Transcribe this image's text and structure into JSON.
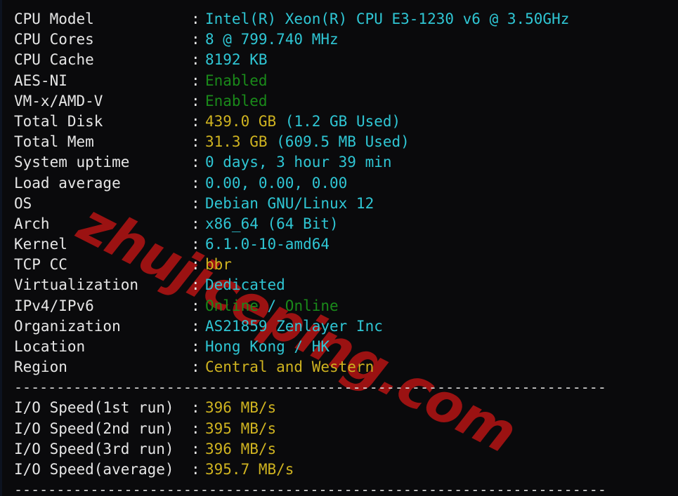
{
  "terminal": {
    "background": "#0a0a0c",
    "watermark": "zhujiceping.com",
    "watermark_color": "#9b1212",
    "separator_top": "----------------------------------------------------------------------",
    "separator_mid": "----------------------------------------------------------------------",
    "separator_bottom": "----------------------------------------------------------------------",
    "colon": ":"
  },
  "colors": {
    "label": "#e6e6e6",
    "cyan": "#2fc6d4",
    "yellow": "#cfb320",
    "green": "#1a8a1a"
  },
  "system_info": [
    {
      "label": "CPU Model",
      "value": "Intel(R) Xeon(R) CPU E3-1230 v6 @ 3.50GHz",
      "color": "cyan"
    },
    {
      "label": "CPU Cores",
      "value": "8 @ 799.740 MHz",
      "color": "cyan"
    },
    {
      "label": "CPU Cache",
      "value": "8192 KB",
      "color": "cyan"
    },
    {
      "label": "AES-NI",
      "value": "Enabled",
      "color": "green"
    },
    {
      "label": "VM-x/AMD-V",
      "value": "Enabled",
      "color": "green"
    },
    {
      "label": "Total Disk",
      "value": "439.0 GB (1.2 GB Used)",
      "color": "split",
      "parts": [
        {
          "text": "439.0 GB ",
          "color": "yellow"
        },
        {
          "text": "(1.2 GB Used)",
          "color": "cyan"
        }
      ]
    },
    {
      "label": "Total Mem",
      "value": "31.3 GB (609.5 MB Used)",
      "color": "split",
      "parts": [
        {
          "text": "31.3 GB ",
          "color": "yellow"
        },
        {
          "text": "(609.5 MB Used)",
          "color": "cyan"
        }
      ]
    },
    {
      "label": "System uptime",
      "value": "0 days, 3 hour 39 min",
      "color": "cyan"
    },
    {
      "label": "Load average",
      "value": "0.00, 0.00, 0.00",
      "color": "cyan"
    },
    {
      "label": "OS",
      "value": "Debian GNU/Linux 12",
      "color": "cyan"
    },
    {
      "label": "Arch",
      "value": "x86_64 (64 Bit)",
      "color": "cyan"
    },
    {
      "label": "Kernel",
      "value": "6.1.0-10-amd64",
      "color": "cyan"
    },
    {
      "label": "TCP CC",
      "value": "bbr",
      "color": "yellow"
    },
    {
      "label": "Virtualization",
      "value": "Dedicated",
      "color": "cyan"
    },
    {
      "label": "IPv4/IPv6",
      "value": "Online / Online",
      "color": "split",
      "parts": [
        {
          "text": "Online",
          "color": "green"
        },
        {
          "text": " / ",
          "color": "cyan"
        },
        {
          "text": "Online",
          "color": "green"
        }
      ]
    },
    {
      "label": "Organization",
      "value": "AS21859 Zenlayer Inc",
      "color": "cyan"
    },
    {
      "label": "Location",
      "value": "Hong Kong / HK",
      "color": "cyan"
    },
    {
      "label": "Region",
      "value": "Central and Western",
      "color": "yellow"
    }
  ],
  "io_speed": [
    {
      "label": "I/O Speed(1st run)",
      "value": "396 MB/s",
      "color": "yellow"
    },
    {
      "label": "I/O Speed(2nd run)",
      "value": "395 MB/s",
      "color": "yellow"
    },
    {
      "label": "I/O Speed(3rd run)",
      "value": "396 MB/s",
      "color": "yellow"
    },
    {
      "label": "I/O Speed(average)",
      "value": "395.7 MB/s",
      "color": "yellow"
    }
  ]
}
